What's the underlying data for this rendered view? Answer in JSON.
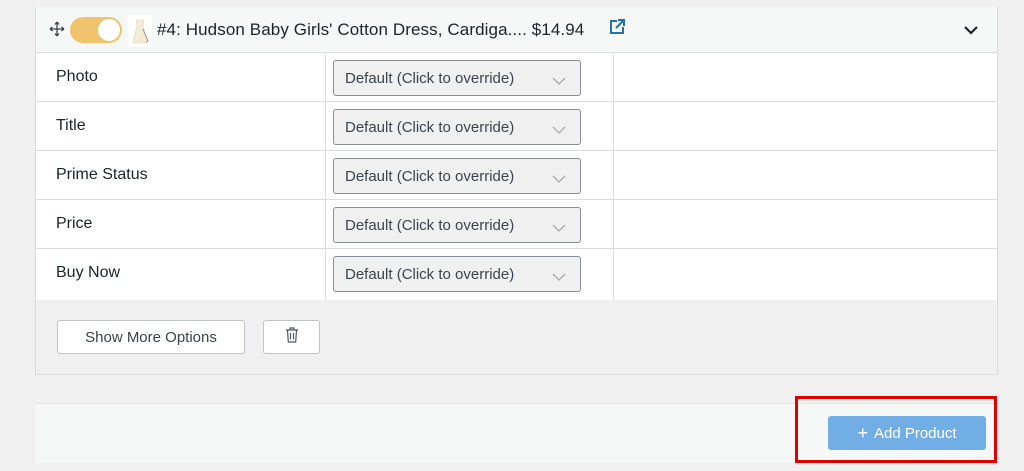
{
  "product": {
    "title": "#4: Hudson Baby Girls' Cotton Dress, Cardiga.... $14.94",
    "enabled": true
  },
  "options": [
    {
      "label": "Photo",
      "value": "Default (Click to override)"
    },
    {
      "label": "Title",
      "value": "Default (Click to override)"
    },
    {
      "label": "Prime Status",
      "value": "Default (Click to override)"
    },
    {
      "label": "Price",
      "value": "Default (Click to override)"
    },
    {
      "label": "Buy Now",
      "value": "Default (Click to override)"
    }
  ],
  "actions": {
    "show_more_label": "Show More Options",
    "add_product_label": "Add Product"
  },
  "icons": {
    "move": "move-icon",
    "external_link": "external-link-icon",
    "collapse": "chevron-down-icon",
    "trash": "trash-icon"
  },
  "colors": {
    "toggle_on": "#f0c36d",
    "primary_button": "#72aee6",
    "link": "#2271b1",
    "highlight": "#e00000"
  }
}
